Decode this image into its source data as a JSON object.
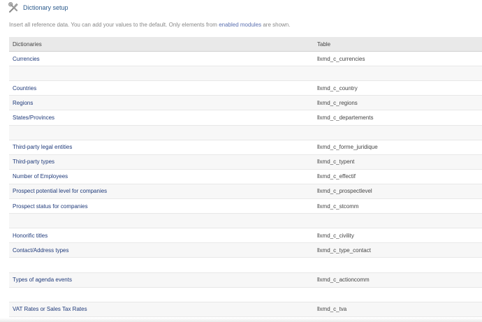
{
  "title": {
    "icon": "tools-icon",
    "text": "Dictionary setup"
  },
  "intro": {
    "before": "Insert all reference data. You can add your values to the default. Only elements from ",
    "link": "enabled modules",
    "after": " are shown."
  },
  "table": {
    "headers": {
      "dictionaries": "Dictionaries",
      "table": "Table"
    },
    "rows": [
      {
        "label": "Currencies",
        "table": "llxmd_c_currencies"
      },
      {
        "label": "",
        "table": ""
      },
      {
        "label": "Countries",
        "table": "llxmd_c_country"
      },
      {
        "label": "Regions",
        "table": "llxmd_c_regions"
      },
      {
        "label": "States/Provinces",
        "table": "llxmd_c_departements"
      },
      {
        "label": "",
        "table": ""
      },
      {
        "label": "Third-party legal entities",
        "table": "llxmd_c_forme_juridique"
      },
      {
        "label": "Third-party types",
        "table": "llxmd_c_typent"
      },
      {
        "label": "Number of Employees",
        "table": "llxmd_c_effectif"
      },
      {
        "label": "Prospect potential level for companies",
        "table": "llxmd_c_prospectlevel"
      },
      {
        "label": "Prospect status for companies",
        "table": "llxmd_c_stcomm"
      },
      {
        "label": "",
        "table": ""
      },
      {
        "label": "Honorific titles",
        "table": "llxmd_c_civility"
      },
      {
        "label": "Contact/Address types",
        "table": "llxmd_c_type_contact"
      },
      {
        "label": "",
        "table": ""
      },
      {
        "label": "Types of agenda events",
        "table": "llxmd_c_actioncomm"
      },
      {
        "label": "",
        "table": ""
      },
      {
        "label": "VAT Rates or Sales Tax Rates",
        "table": "llxmd_c_tva"
      }
    ]
  },
  "colors": {
    "title": "#2b5a8c",
    "link": "#1f3a7a",
    "header_bg": "#e9e9e9",
    "stripe_bg": "#f7f7f7"
  }
}
